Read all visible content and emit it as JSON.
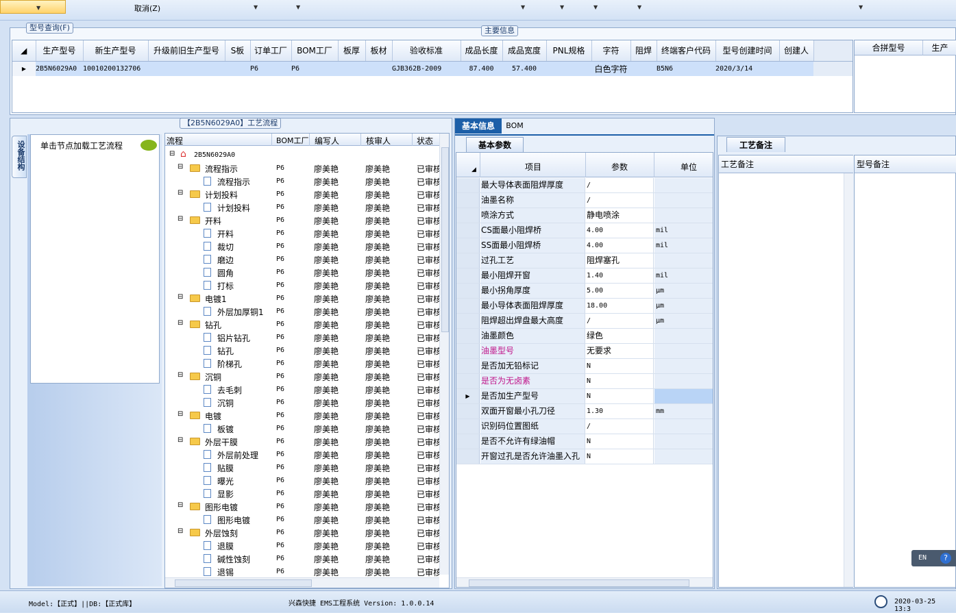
{
  "toolbar": {
    "cancel_label": "取消(Z)"
  },
  "query": {
    "title": "型号查询(F)",
    "main_info": "主要信息",
    "columns": [
      "生产型号",
      "新生产型号",
      "升级前旧生产型号",
      "S板",
      "订单工厂",
      "BOM工厂",
      "板厚",
      "板材",
      "验收标准",
      "成品长度",
      "成品宽度",
      "PNL规格",
      "字符",
      "阻焊",
      "终端客户代码",
      "型号创建时间",
      "创建人"
    ],
    "row": [
      "2B5N6029A0",
      "10010200132706",
      "",
      "",
      "P6",
      "P6",
      "",
      "",
      "GJB362B-2009",
      "87.400",
      "57.400",
      "",
      "白色字符",
      "",
      "B5N6",
      "2020/3/14",
      ""
    ],
    "right_columns": [
      "合拼型号",
      "生产"
    ]
  },
  "flow": {
    "title": "【2B5N6029A0】工艺流程",
    "side_tab": "设备结构",
    "load_hint": "单击节点加载工艺流程",
    "columns": [
      "流程",
      "BOM工厂",
      "编写人",
      "核审人",
      "状态"
    ],
    "root": "2B5N6029A0",
    "rows": [
      {
        "name": "流程指示",
        "level": 1,
        "folder": true
      },
      {
        "name": "流程指示",
        "level": 2,
        "folder": false
      },
      {
        "name": "计划投料",
        "level": 1,
        "folder": true
      },
      {
        "name": "计划投料",
        "level": 2,
        "folder": false
      },
      {
        "name": "开料",
        "level": 1,
        "folder": true
      },
      {
        "name": "开料",
        "level": 2,
        "folder": false
      },
      {
        "name": "裁切",
        "level": 2,
        "folder": false
      },
      {
        "name": "磨边",
        "level": 2,
        "folder": false
      },
      {
        "name": "圆角",
        "level": 2,
        "folder": false
      },
      {
        "name": "打标",
        "level": 2,
        "folder": false
      },
      {
        "name": "电镀1",
        "level": 1,
        "folder": true
      },
      {
        "name": "外层加厚铜1",
        "level": 2,
        "folder": false
      },
      {
        "name": "钻孔",
        "level": 1,
        "folder": true
      },
      {
        "name": "铝片钻孔",
        "level": 2,
        "folder": false
      },
      {
        "name": "钻孔",
        "level": 2,
        "folder": false
      },
      {
        "name": "阶梯孔",
        "level": 2,
        "folder": false
      },
      {
        "name": "沉铜",
        "level": 1,
        "folder": true
      },
      {
        "name": "去毛刺",
        "level": 2,
        "folder": false
      },
      {
        "name": "沉铜",
        "level": 2,
        "folder": false
      },
      {
        "name": "电镀",
        "level": 1,
        "folder": true
      },
      {
        "name": "板镀",
        "level": 2,
        "folder": false
      },
      {
        "name": "外层干膜",
        "level": 1,
        "folder": true
      },
      {
        "name": "外层前处理",
        "level": 2,
        "folder": false
      },
      {
        "name": "贴膜",
        "level": 2,
        "folder": false
      },
      {
        "name": "曝光",
        "level": 2,
        "folder": false
      },
      {
        "name": "显影",
        "level": 2,
        "folder": false
      },
      {
        "name": "图形电镀",
        "level": 1,
        "folder": true
      },
      {
        "name": "图形电镀",
        "level": 2,
        "folder": false
      },
      {
        "name": "外层蚀刻",
        "level": 1,
        "folder": true
      },
      {
        "name": "退膜",
        "level": 2,
        "folder": false
      },
      {
        "name": "碱性蚀刻",
        "level": 2,
        "folder": false
      },
      {
        "name": "退锡",
        "level": 2,
        "folder": false
      }
    ],
    "bom": "P6",
    "writer": "廖美艳",
    "checker": "廖美艳",
    "status": "已审核"
  },
  "info": {
    "tabs": [
      "基本信息",
      "BOM"
    ],
    "subtab": "基本参数",
    "columns": [
      "项目",
      "参数",
      "单位"
    ],
    "rows": [
      {
        "item": "最大导体表面阻焊厚度",
        "value": "/",
        "unit": "",
        "pink": false
      },
      {
        "item": "油墨名称",
        "value": "/",
        "unit": "",
        "pink": false
      },
      {
        "item": "喷涂方式",
        "value": "静电喷涂",
        "unit": "",
        "pink": false
      },
      {
        "item": "CS面最小阻焊桥",
        "value": "4.00",
        "unit": "mil",
        "pink": false
      },
      {
        "item": "SS面最小阻焊桥",
        "value": "4.00",
        "unit": "mil",
        "pink": false
      },
      {
        "item": "过孔工艺",
        "value": "阻焊塞孔",
        "unit": "",
        "pink": false
      },
      {
        "item": "最小阻焊开窗",
        "value": "1.40",
        "unit": "mil",
        "pink": false
      },
      {
        "item": "最小拐角厚度",
        "value": "5.00",
        "unit": "μm",
        "pink": false
      },
      {
        "item": "最小导体表面阻焊厚度",
        "value": "18.00",
        "unit": "μm",
        "pink": false
      },
      {
        "item": "阻焊超出焊盘最大高度",
        "value": "/",
        "unit": "μm",
        "pink": false
      },
      {
        "item": "油墨颜色",
        "value": "绿色",
        "unit": "",
        "pink": false
      },
      {
        "item": "油墨型号",
        "value": "无要求",
        "unit": "",
        "pink": true
      },
      {
        "item": "是否加无铅标记",
        "value": "N",
        "unit": "",
        "pink": false
      },
      {
        "item": "是否为无卤素",
        "value": "N",
        "unit": "",
        "pink": true
      },
      {
        "item": "是否加生产型号",
        "value": "N",
        "unit": "",
        "pink": false
      },
      {
        "item": "双面开窗最小孔刀径",
        "value": "1.30",
        "unit": "mm",
        "pink": false
      },
      {
        "item": "识别码位置图纸",
        "value": "/",
        "unit": "",
        "pink": false
      },
      {
        "item": "是否不允许有绿油帽",
        "value": "N",
        "unit": "",
        "pink": false
      },
      {
        "item": "开窗过孔是否允许油墨入孔",
        "value": "N",
        "unit": "",
        "pink": false
      }
    ]
  },
  "notes": {
    "tab": "工艺备注",
    "col1": "工艺备注",
    "col2": "型号备注"
  },
  "lang": "EN",
  "status": {
    "model": "Model:【正式】||DB:【正式库】",
    "app": "兴森快捷 EMS工程系统 Version: 1.0.0.14",
    "datetime": "2020-03-25 13:3"
  },
  "colors": {
    "selection": "#cde0fa",
    "accent": "#1c5fa8",
    "pink": "#c0168a"
  }
}
